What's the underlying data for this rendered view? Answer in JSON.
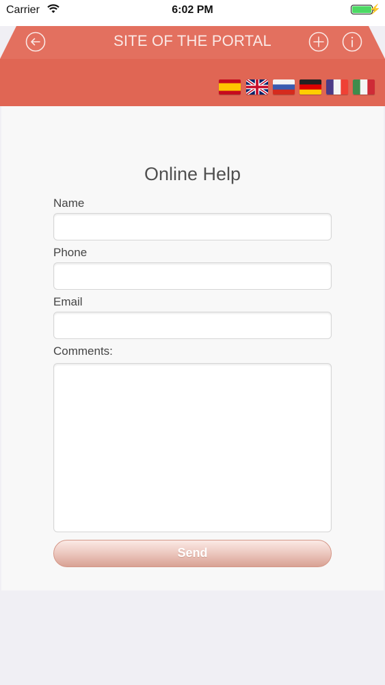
{
  "status_bar": {
    "carrier": "Carrier",
    "time": "6:02 PM"
  },
  "header": {
    "title": "SITE OF THE PORTAL",
    "background_color": "#e06654",
    "icons": [
      "back-arrow-icon",
      "plus-icon",
      "info-icon"
    ]
  },
  "languages": [
    "spanish-flag",
    "english-flag",
    "russian-flag",
    "german-flag",
    "french-flag",
    "italian-flag"
  ],
  "form": {
    "title": "Online Help",
    "fields": [
      {
        "label": "Name",
        "value": ""
      },
      {
        "label": "Phone",
        "value": ""
      },
      {
        "label": "Email",
        "value": ""
      }
    ],
    "comments_label": "Comments:",
    "comments_value": "",
    "send_label": "Send"
  }
}
